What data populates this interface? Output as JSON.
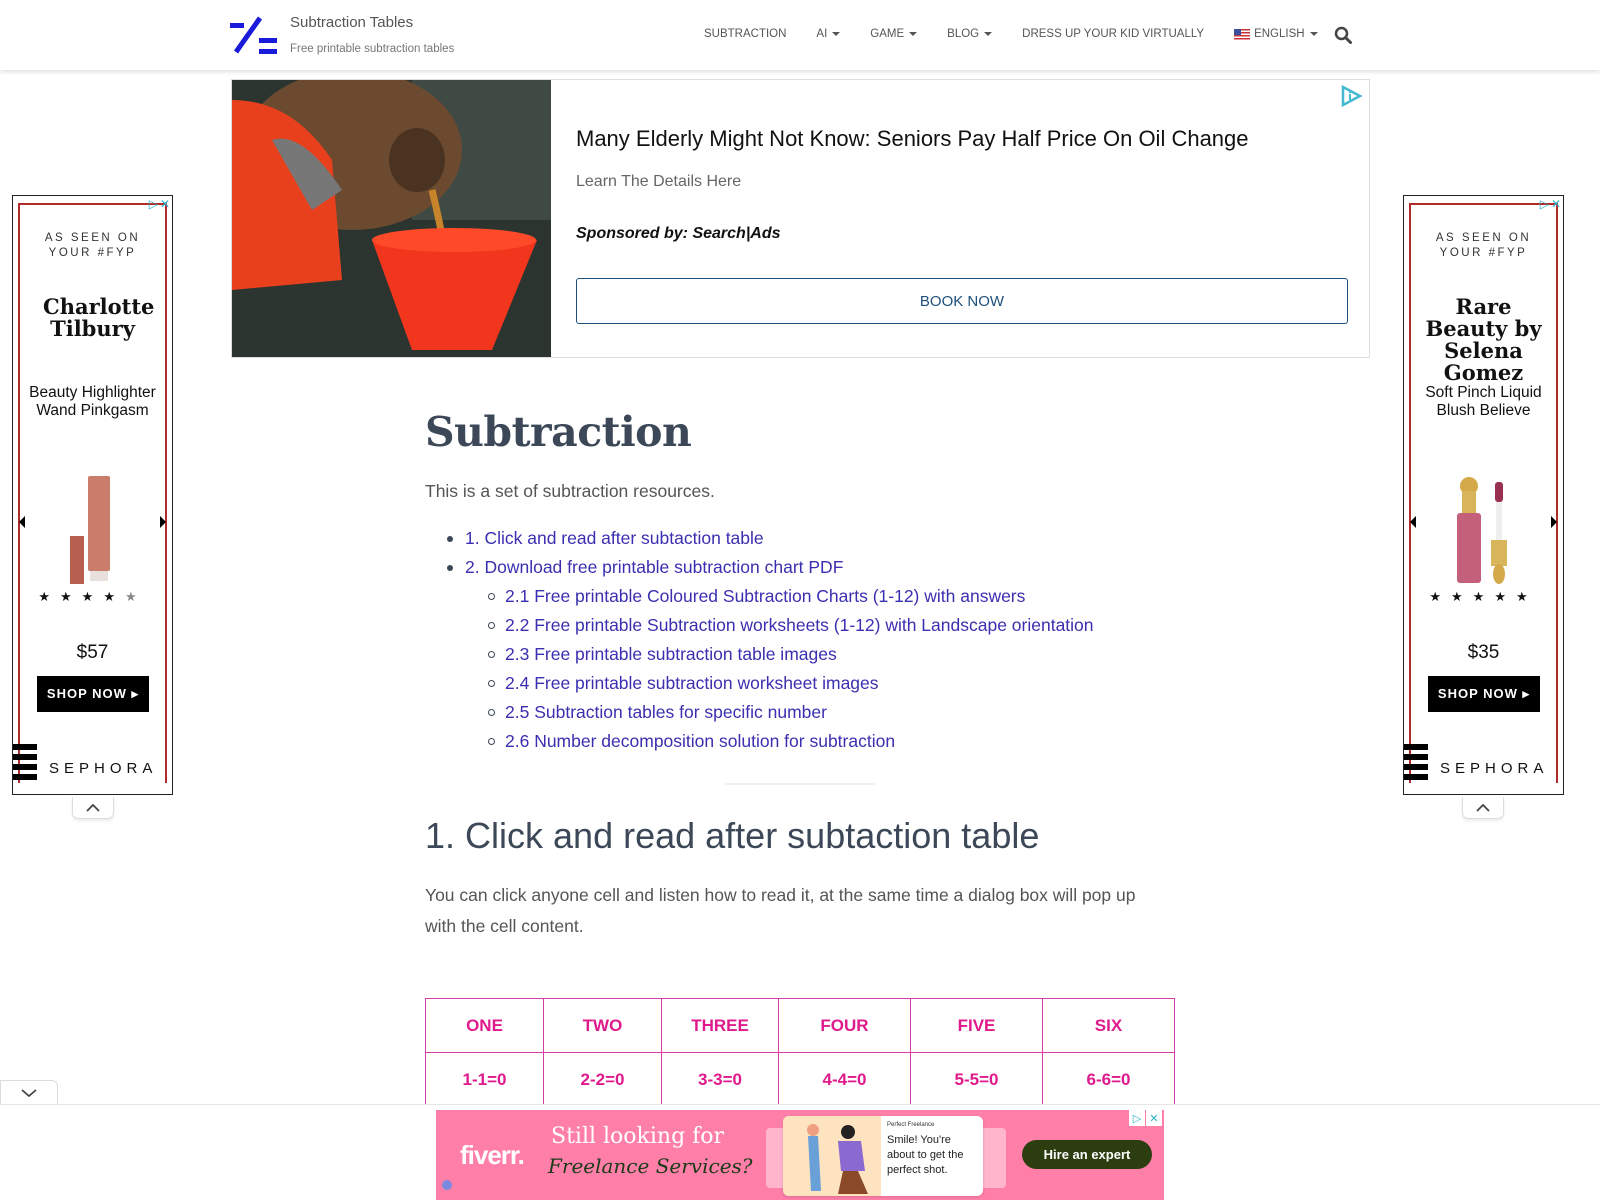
{
  "header": {
    "site_title": "Subtraction Tables",
    "site_subtitle": "Free printable subtraction tables",
    "nav": [
      {
        "label": "SUBTRACTION",
        "has_dropdown": false
      },
      {
        "label": "AI",
        "has_dropdown": true
      },
      {
        "label": "GAME",
        "has_dropdown": true
      },
      {
        "label": "BLOG",
        "has_dropdown": true
      },
      {
        "label": "DRESS UP YOUR KID VIRTUALLY",
        "has_dropdown": false
      },
      {
        "label": "ENGLISH",
        "has_dropdown": true,
        "icon": "us-flag-icon"
      }
    ],
    "search_icon": "search-icon",
    "brand_color": "#1a1adb"
  },
  "top_ad": {
    "headline": "Many Elderly Might Not Know: Seniors Pay Half Price On Oil Change",
    "description": "Learn The Details Here",
    "sponsor": "Sponsored by: Search|Ads",
    "cta": "BOOK NOW",
    "image": "oil-pouring-into-funnel-image",
    "cta_color": "#1d4f7c"
  },
  "side_ads": [
    {
      "seen_on": "AS SEEN ON YOUR #FYP",
      "brand": "Charlotte Tilbury",
      "product": "Beauty Highlighter Wand Pinkgasm",
      "rating": 4,
      "rating_max": 5,
      "price": "$57",
      "cta": "SHOP NOW ▸",
      "retailer": "SEPHORA"
    },
    {
      "seen_on": "AS SEEN ON YOUR #FYP",
      "brand": "Rare Beauty by Selena Gomez",
      "product": "Soft Pinch Liquid Blush Believe",
      "rating": 5,
      "rating_max": 5,
      "price": "$35",
      "cta": "SHOP NOW ▸",
      "retailer": "SEPHORA"
    }
  ],
  "main": {
    "title": "Subtraction",
    "intro": "This is a set of subtraction resources.",
    "toc": [
      {
        "level": 1,
        "label": "1. Click and read after subtaction table"
      },
      {
        "level": 1,
        "label": "2. Download free printable subtraction chart PDF"
      },
      {
        "level": 2,
        "label": "2.1 Free printable Coloured Subtraction Charts (1-12) with answers"
      },
      {
        "level": 2,
        "label": "2.2 Free printable Subtraction worksheets (1-12) with Landscape orientation"
      },
      {
        "level": 2,
        "label": "2.3 Free printable subtraction table images"
      },
      {
        "level": 2,
        "label": "2.4 Free printable subtraction worksheet images"
      },
      {
        "level": 2,
        "label": "2.5 Subtraction tables for specific number"
      },
      {
        "level": 2,
        "label": "2.6 Number decomposition solution for subtraction"
      }
    ],
    "link_color": "#3a2fb0",
    "section1_title": "1. Click and read after subtaction table",
    "section1_text": "You can click anyone cell and listen how to read it, at the same time a dialog box will pop up with the cell content."
  },
  "table": {
    "headers": [
      "ONE",
      "TWO",
      "THREE",
      "FOUR",
      "FIVE",
      "SIX"
    ],
    "rows": [
      [
        "1-1=0",
        "2-2=0",
        "3-3=0",
        "4-4=0",
        "5-5=0",
        "6-6=0"
      ]
    ],
    "accent_color": "#e01a8c"
  },
  "bottom_ad": {
    "logo": "fiverr.",
    "line1": "Still looking for",
    "line2": "Freelance Services?",
    "card_tag": "Perfect Freelance",
    "card_text": "Smile! You're about to get the perfect shot.",
    "cta": "Hire an expert",
    "background": "#ff7fa8"
  }
}
